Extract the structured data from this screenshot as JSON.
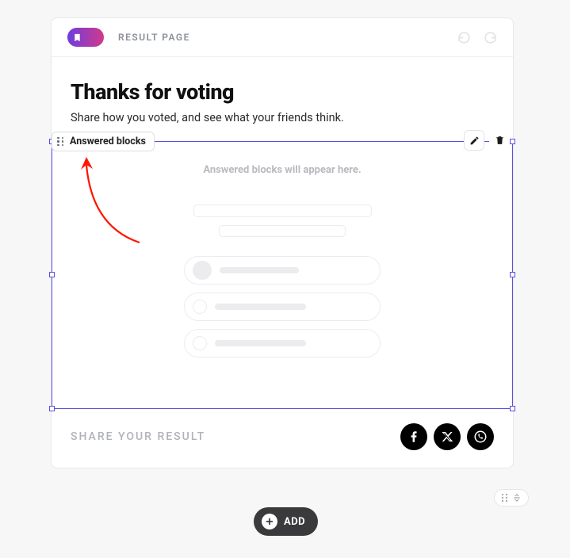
{
  "header": {
    "page_label": "RESULT PAGE"
  },
  "heading": {
    "title": "Thanks for voting",
    "subtitle": "Share how you voted, and see what your friends think."
  },
  "block": {
    "label": "Answered blocks",
    "placeholder": "Answered blocks will appear here."
  },
  "share": {
    "label": "SHARE YOUR RESULT"
  },
  "add_button": {
    "label": "ADD"
  }
}
